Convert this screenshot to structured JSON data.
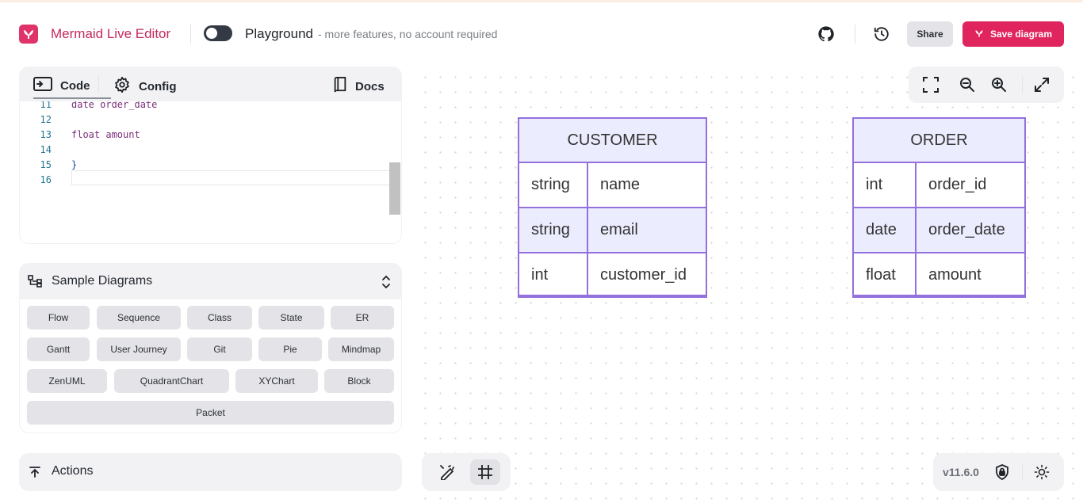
{
  "header": {
    "app_title": "Mermaid Live Editor",
    "playground_label": "Playground",
    "playground_sub": "- more features, no account required",
    "share_label": "Share",
    "save_label": "Save diagram"
  },
  "editor": {
    "tabs": {
      "code": "Code",
      "config": "Config",
      "docs": "Docs"
    },
    "lines": [
      {
        "num": "11",
        "text": "date order_date"
      },
      {
        "num": "12",
        "text": ""
      },
      {
        "num": "13",
        "text": "float amount"
      },
      {
        "num": "14",
        "text": ""
      },
      {
        "num": "15",
        "text": "}"
      },
      {
        "num": "16",
        "text": ""
      }
    ]
  },
  "samples": {
    "title": "Sample Diagrams",
    "items": [
      "Flow",
      "Sequence",
      "Class",
      "State",
      "ER",
      "Gantt",
      "User Journey",
      "Git",
      "Pie",
      "Mindmap",
      "ZenUML",
      "QuadrantChart",
      "XYChart",
      "Block",
      "Packet"
    ]
  },
  "actions": {
    "label": "Actions"
  },
  "diagram": {
    "customer": {
      "title": "CUSTOMER",
      "rows": [
        {
          "type": "string",
          "name": "name"
        },
        {
          "type": "string",
          "name": "email"
        },
        {
          "type": "int",
          "name": "customer_id"
        }
      ]
    },
    "order": {
      "title": "ORDER",
      "rows": [
        {
          "type": "int",
          "name": "order_id"
        },
        {
          "type": "date",
          "name": "order_date"
        },
        {
          "type": "float",
          "name": "amount"
        }
      ]
    }
  },
  "footer": {
    "version": "v11.6.0"
  },
  "colors": {
    "brand": "#e0245e",
    "entity_border": "#9370db",
    "entity_fill": "#ececff"
  }
}
